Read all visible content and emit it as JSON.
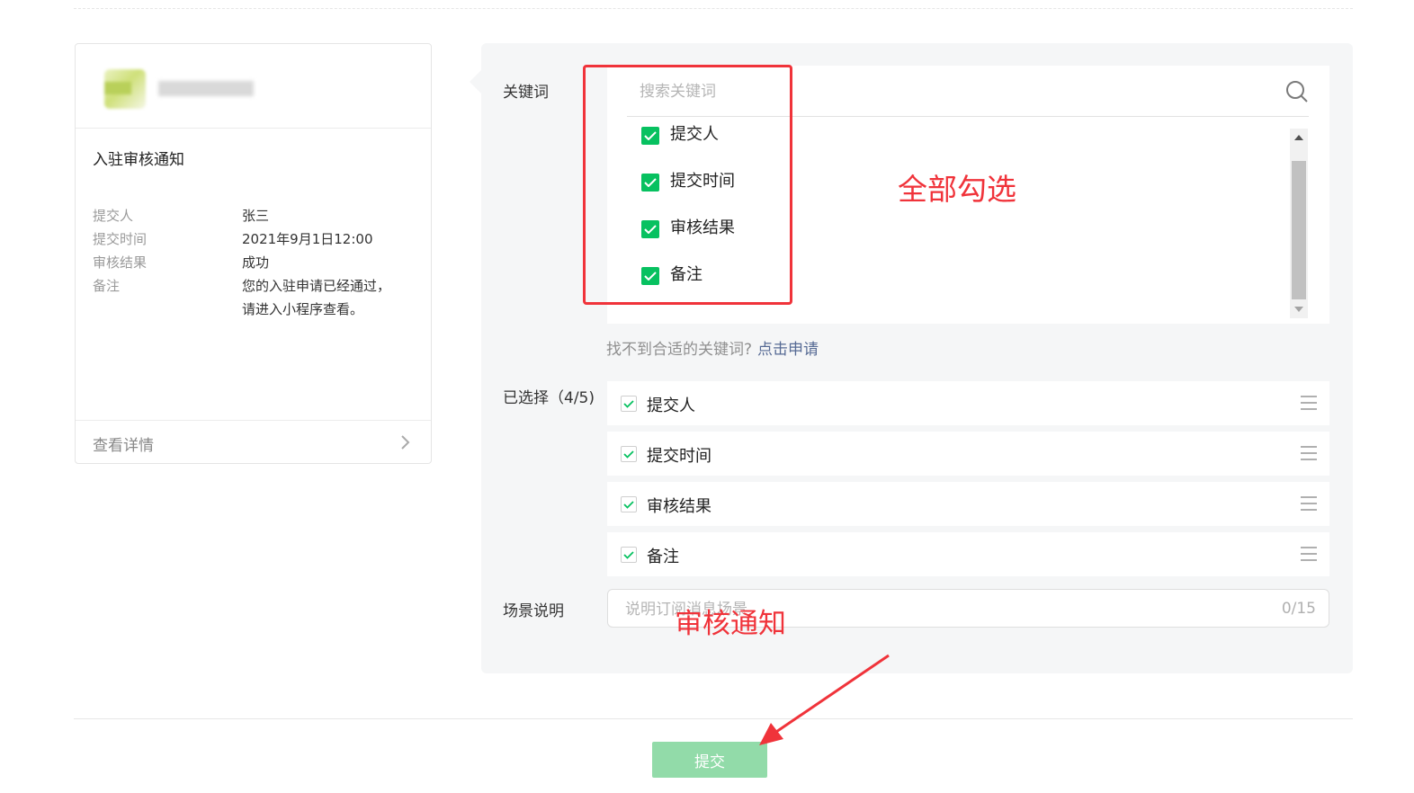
{
  "preview": {
    "notice_title": "入驻审核通知",
    "fields": [
      {
        "key": "提交人",
        "value": "张三"
      },
      {
        "key": "提交时间",
        "value": "2021年9月1日12:00"
      },
      {
        "key": "审核结果",
        "value": "成功"
      },
      {
        "key": "备注",
        "value": "您的入驻申请已经通过，",
        "value2": "请进入小程序查看。"
      }
    ],
    "view_details": "查看详情"
  },
  "form": {
    "keywords_label": "关键词",
    "search_placeholder": "搜索关键词",
    "keyword_options": [
      {
        "label": "提交人",
        "checked": true
      },
      {
        "label": "提交时间",
        "checked": true
      },
      {
        "label": "审核结果",
        "checked": true
      },
      {
        "label": "备注",
        "checked": true
      }
    ],
    "hint_text": "找不到合适的关键词?",
    "hint_link": "点击申请",
    "selected_label": "已选择（4/5)",
    "selected_items": [
      "提交人",
      "提交时间",
      "审核结果",
      "备注"
    ],
    "scene_label": "场景说明",
    "scene_placeholder": "说明订阅消息场景",
    "scene_counter": "0/15"
  },
  "annotations": {
    "select_all": "全部勾选",
    "scene_example": "审核通知",
    "color": "#f0333a"
  },
  "submit_label": "提交",
  "colors": {
    "accent_green": "#07c160",
    "submit_disabled": "#92dba9",
    "link": "#576b95",
    "panel_bg": "#f5f6f7"
  }
}
